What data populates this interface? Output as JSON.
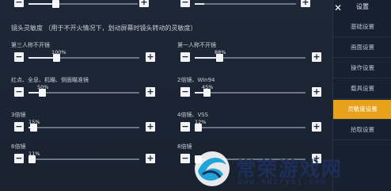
{
  "sidebar": {
    "title": "设置",
    "items": [
      {
        "label": "基础设置",
        "active": false
      },
      {
        "label": "画面设置",
        "active": false
      },
      {
        "label": "操作设置",
        "active": false
      },
      {
        "label": "载具设置",
        "active": false
      },
      {
        "label": "灵敏度设置",
        "active": true
      },
      {
        "label": "拾取设置",
        "active": false
      }
    ],
    "active_color": "#e8a11a"
  },
  "section_title": "镜头灵敏度 （用于不开火情况下，划动屏幕时镜头转动的灵敏度）",
  "sliders": [
    {
      "id": "third",
      "label": "第三人称不开镜",
      "value_text": "100%",
      "fraction": 0.25
    },
    {
      "id": "first",
      "label": "第一人称不开镜",
      "value_text": "88%",
      "fraction": 0.22
    },
    {
      "id": "red",
      "label": "红点、全息、机瞄、侧面瞄准镜",
      "value_text": "50%",
      "fraction": 0.12
    },
    {
      "id": "x2",
      "label": "2倍镜、Win94",
      "value_text": "45%",
      "fraction": 0.11
    },
    {
      "id": "x3",
      "label": "3倍镜",
      "value_text": "15%",
      "fraction": 0.04
    },
    {
      "id": "x4",
      "label": "4倍镜、VSS",
      "value_text": "12%",
      "fraction": 0.03
    },
    {
      "id": "x6",
      "label": "6倍镜",
      "value_text": "11%",
      "fraction": 0.03
    },
    {
      "id": "x8",
      "label": "8倍镜",
      "value_text": "",
      "fraction": 0.03
    }
  ],
  "watermark": {
    "brand": "常荣游戏网",
    "url": "www.sdcrysj.com"
  }
}
